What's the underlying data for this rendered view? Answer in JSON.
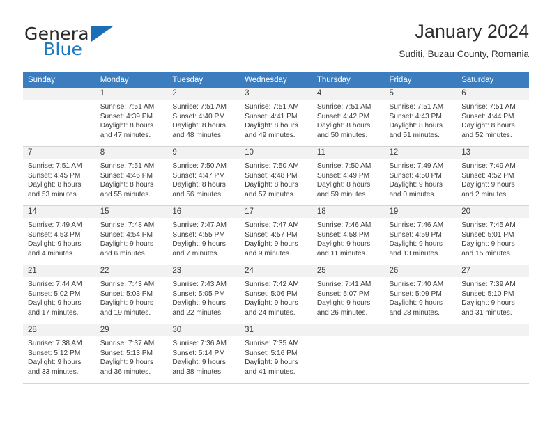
{
  "brand": {
    "word_one": "General",
    "word_two": "Blue",
    "triangle_icon": "triangle-icon",
    "accent_color": "#1c7ac0",
    "header_color": "#3b7dbf"
  },
  "header": {
    "title": "January 2024",
    "subtitle": "Suditi, Buzau County, Romania"
  },
  "weekday_headers": [
    "Sunday",
    "Monday",
    "Tuesday",
    "Wednesday",
    "Thursday",
    "Friday",
    "Saturday"
  ],
  "labels": {
    "sunrise_prefix": "Sunrise:",
    "sunset_prefix": "Sunset:",
    "daylight_prefix": "Daylight:"
  },
  "weeks": [
    [
      {
        "day": "",
        "sunrise": "",
        "sunset": "",
        "daylight_line1": "",
        "daylight_line2": ""
      },
      {
        "day": "1",
        "sunrise": "Sunrise: 7:51 AM",
        "sunset": "Sunset: 4:39 PM",
        "daylight_line1": "Daylight: 8 hours",
        "daylight_line2": "and 47 minutes."
      },
      {
        "day": "2",
        "sunrise": "Sunrise: 7:51 AM",
        "sunset": "Sunset: 4:40 PM",
        "daylight_line1": "Daylight: 8 hours",
        "daylight_line2": "and 48 minutes."
      },
      {
        "day": "3",
        "sunrise": "Sunrise: 7:51 AM",
        "sunset": "Sunset: 4:41 PM",
        "daylight_line1": "Daylight: 8 hours",
        "daylight_line2": "and 49 minutes."
      },
      {
        "day": "4",
        "sunrise": "Sunrise: 7:51 AM",
        "sunset": "Sunset: 4:42 PM",
        "daylight_line1": "Daylight: 8 hours",
        "daylight_line2": "and 50 minutes."
      },
      {
        "day": "5",
        "sunrise": "Sunrise: 7:51 AM",
        "sunset": "Sunset: 4:43 PM",
        "daylight_line1": "Daylight: 8 hours",
        "daylight_line2": "and 51 minutes."
      },
      {
        "day": "6",
        "sunrise": "Sunrise: 7:51 AM",
        "sunset": "Sunset: 4:44 PM",
        "daylight_line1": "Daylight: 8 hours",
        "daylight_line2": "and 52 minutes."
      }
    ],
    [
      {
        "day": "7",
        "sunrise": "Sunrise: 7:51 AM",
        "sunset": "Sunset: 4:45 PM",
        "daylight_line1": "Daylight: 8 hours",
        "daylight_line2": "and 53 minutes."
      },
      {
        "day": "8",
        "sunrise": "Sunrise: 7:51 AM",
        "sunset": "Sunset: 4:46 PM",
        "daylight_line1": "Daylight: 8 hours",
        "daylight_line2": "and 55 minutes."
      },
      {
        "day": "9",
        "sunrise": "Sunrise: 7:50 AM",
        "sunset": "Sunset: 4:47 PM",
        "daylight_line1": "Daylight: 8 hours",
        "daylight_line2": "and 56 minutes."
      },
      {
        "day": "10",
        "sunrise": "Sunrise: 7:50 AM",
        "sunset": "Sunset: 4:48 PM",
        "daylight_line1": "Daylight: 8 hours",
        "daylight_line2": "and 57 minutes."
      },
      {
        "day": "11",
        "sunrise": "Sunrise: 7:50 AM",
        "sunset": "Sunset: 4:49 PM",
        "daylight_line1": "Daylight: 8 hours",
        "daylight_line2": "and 59 minutes."
      },
      {
        "day": "12",
        "sunrise": "Sunrise: 7:49 AM",
        "sunset": "Sunset: 4:50 PM",
        "daylight_line1": "Daylight: 9 hours",
        "daylight_line2": "and 0 minutes."
      },
      {
        "day": "13",
        "sunrise": "Sunrise: 7:49 AM",
        "sunset": "Sunset: 4:52 PM",
        "daylight_line1": "Daylight: 9 hours",
        "daylight_line2": "and 2 minutes."
      }
    ],
    [
      {
        "day": "14",
        "sunrise": "Sunrise: 7:49 AM",
        "sunset": "Sunset: 4:53 PM",
        "daylight_line1": "Daylight: 9 hours",
        "daylight_line2": "and 4 minutes."
      },
      {
        "day": "15",
        "sunrise": "Sunrise: 7:48 AM",
        "sunset": "Sunset: 4:54 PM",
        "daylight_line1": "Daylight: 9 hours",
        "daylight_line2": "and 6 minutes."
      },
      {
        "day": "16",
        "sunrise": "Sunrise: 7:47 AM",
        "sunset": "Sunset: 4:55 PM",
        "daylight_line1": "Daylight: 9 hours",
        "daylight_line2": "and 7 minutes."
      },
      {
        "day": "17",
        "sunrise": "Sunrise: 7:47 AM",
        "sunset": "Sunset: 4:57 PM",
        "daylight_line1": "Daylight: 9 hours",
        "daylight_line2": "and 9 minutes."
      },
      {
        "day": "18",
        "sunrise": "Sunrise: 7:46 AM",
        "sunset": "Sunset: 4:58 PM",
        "daylight_line1": "Daylight: 9 hours",
        "daylight_line2": "and 11 minutes."
      },
      {
        "day": "19",
        "sunrise": "Sunrise: 7:46 AM",
        "sunset": "Sunset: 4:59 PM",
        "daylight_line1": "Daylight: 9 hours",
        "daylight_line2": "and 13 minutes."
      },
      {
        "day": "20",
        "sunrise": "Sunrise: 7:45 AM",
        "sunset": "Sunset: 5:01 PM",
        "daylight_line1": "Daylight: 9 hours",
        "daylight_line2": "and 15 minutes."
      }
    ],
    [
      {
        "day": "21",
        "sunrise": "Sunrise: 7:44 AM",
        "sunset": "Sunset: 5:02 PM",
        "daylight_line1": "Daylight: 9 hours",
        "daylight_line2": "and 17 minutes."
      },
      {
        "day": "22",
        "sunrise": "Sunrise: 7:43 AM",
        "sunset": "Sunset: 5:03 PM",
        "daylight_line1": "Daylight: 9 hours",
        "daylight_line2": "and 19 minutes."
      },
      {
        "day": "23",
        "sunrise": "Sunrise: 7:43 AM",
        "sunset": "Sunset: 5:05 PM",
        "daylight_line1": "Daylight: 9 hours",
        "daylight_line2": "and 22 minutes."
      },
      {
        "day": "24",
        "sunrise": "Sunrise: 7:42 AM",
        "sunset": "Sunset: 5:06 PM",
        "daylight_line1": "Daylight: 9 hours",
        "daylight_line2": "and 24 minutes."
      },
      {
        "day": "25",
        "sunrise": "Sunrise: 7:41 AM",
        "sunset": "Sunset: 5:07 PM",
        "daylight_line1": "Daylight: 9 hours",
        "daylight_line2": "and 26 minutes."
      },
      {
        "day": "26",
        "sunrise": "Sunrise: 7:40 AM",
        "sunset": "Sunset: 5:09 PM",
        "daylight_line1": "Daylight: 9 hours",
        "daylight_line2": "and 28 minutes."
      },
      {
        "day": "27",
        "sunrise": "Sunrise: 7:39 AM",
        "sunset": "Sunset: 5:10 PM",
        "daylight_line1": "Daylight: 9 hours",
        "daylight_line2": "and 31 minutes."
      }
    ],
    [
      {
        "day": "28",
        "sunrise": "Sunrise: 7:38 AM",
        "sunset": "Sunset: 5:12 PM",
        "daylight_line1": "Daylight: 9 hours",
        "daylight_line2": "and 33 minutes."
      },
      {
        "day": "29",
        "sunrise": "Sunrise: 7:37 AM",
        "sunset": "Sunset: 5:13 PM",
        "daylight_line1": "Daylight: 9 hours",
        "daylight_line2": "and 36 minutes."
      },
      {
        "day": "30",
        "sunrise": "Sunrise: 7:36 AM",
        "sunset": "Sunset: 5:14 PM",
        "daylight_line1": "Daylight: 9 hours",
        "daylight_line2": "and 38 minutes."
      },
      {
        "day": "31",
        "sunrise": "Sunrise: 7:35 AM",
        "sunset": "Sunset: 5:16 PM",
        "daylight_line1": "Daylight: 9 hours",
        "daylight_line2": "and 41 minutes."
      },
      {
        "day": "",
        "sunrise": "",
        "sunset": "",
        "daylight_line1": "",
        "daylight_line2": ""
      },
      {
        "day": "",
        "sunrise": "",
        "sunset": "",
        "daylight_line1": "",
        "daylight_line2": ""
      },
      {
        "day": "",
        "sunrise": "",
        "sunset": "",
        "daylight_line1": "",
        "daylight_line2": ""
      }
    ]
  ]
}
